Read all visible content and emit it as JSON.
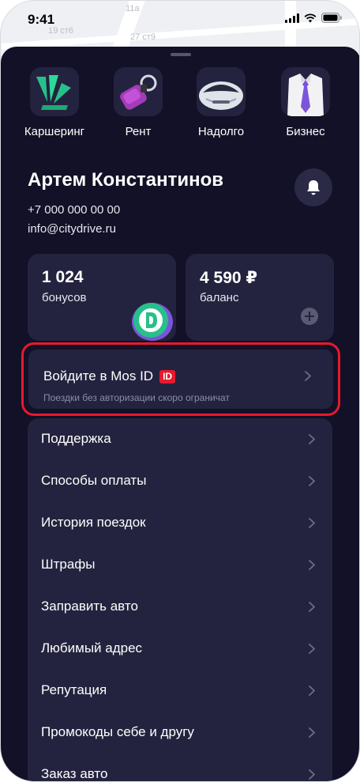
{
  "status_bar": {
    "time": "9:41"
  },
  "map_labels": [
    "11а",
    "19 ст6",
    "27 ст9"
  ],
  "services": [
    {
      "label": "Каршеринг",
      "icon": "carsharing-logo-icon"
    },
    {
      "label": "Рент",
      "icon": "car-key-icon"
    },
    {
      "label": "Надолго",
      "icon": "car-front-icon"
    },
    {
      "label": "Бизнес",
      "icon": "shirt-tie-icon"
    }
  ],
  "profile": {
    "name": "Артем Константинов",
    "phone": "+7 000 000 00 00",
    "email": "info@citydrive.ru"
  },
  "bonuses": {
    "value": "1 024",
    "label": "бонусов"
  },
  "balance": {
    "value": "4 590 ₽",
    "label": "баланс"
  },
  "mos_id": {
    "title": "Войдите в Mos ID",
    "badge": "ID",
    "hint": "Поездки без авторизации скоро ограничат"
  },
  "menu": [
    {
      "label": "Поддержка"
    },
    {
      "label": "Способы оплаты"
    },
    {
      "label": "История поездок"
    },
    {
      "label": "Штрафы"
    },
    {
      "label": "Заправить авто"
    },
    {
      "label": "Любимый адрес"
    },
    {
      "label": "Репутация"
    },
    {
      "label": "Промокоды себе и другу"
    },
    {
      "label": "Заказ авто"
    }
  ],
  "colors": {
    "sheet_bg": "#121127",
    "card_bg": "#24233f",
    "accent_red": "#e8192c",
    "accent_green": "#27c08a"
  }
}
